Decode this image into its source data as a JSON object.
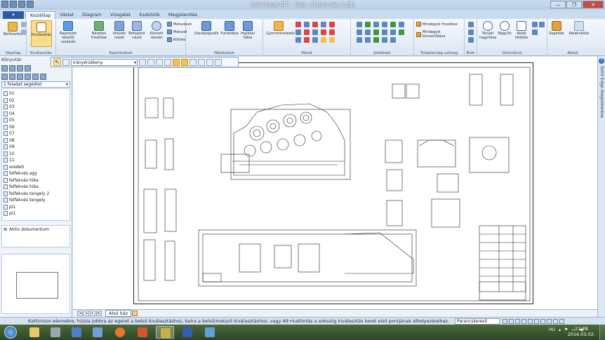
{
  "window": {
    "title": "Solid Edge ST7 - Rajz - [Teljes ház 2.dft]",
    "controls": [
      "—",
      "❐",
      "✕"
    ]
  },
  "tabs": [
    {
      "label": "Kezdőlap",
      "active": true
    },
    {
      "label": "Vázlat"
    },
    {
      "label": "Diagram"
    },
    {
      "label": "Vizsgálat"
    },
    {
      "label": "Eszközök"
    },
    {
      "label": "Megjelenítés"
    }
  ],
  "ribbon": {
    "groups": [
      {
        "name": "Vágólap",
        "buttons": [
          "Beillesztés"
        ]
      },
      {
        "name": "Kiválasztás",
        "buttons": [
          "Kiválasztás"
        ]
      },
      {
        "name": "Rajznézetek",
        "buttons": [
          "Rajznézet készítő varázsló",
          "Nézetek frissítése",
          "Vetületi nézet",
          "Befoglaló nézet",
          "Kiemelt részlet"
        ],
        "small": [
          "Metszések",
          "Metszet",
          "Kitörés"
        ]
      },
      {
        "name": "Táblázatok",
        "buttons": [
          "Darabjegyzék",
          "Furattábla",
          "Hajlítási tábla"
        ]
      },
      {
        "name": "Méret",
        "buttons": [
          "Gyorsméretezés"
        ]
      },
      {
        "name": "Jelölések",
        "buttons": []
      },
      {
        "name": "Tulajdonság szöveg",
        "small": [
          "Mindegyik frissítése",
          "Mindegyik konvertálása"
        ]
      },
      {
        "name": "Élek",
        "buttons": []
      },
      {
        "name": "Orientáció",
        "buttons": [
          "Terület nagyítása",
          "Nagyító",
          "Ablak kitöltés"
        ]
      },
      {
        "name": "Ablak",
        "buttons": [
          "Segédek",
          "Ablakváltás"
        ]
      }
    ]
  },
  "library": {
    "title": "Könyvtár",
    "dropdown": "1 feladat segédlet",
    "items": [
      "01",
      "02",
      "03",
      "04",
      "05",
      "06",
      "07",
      "08",
      "09",
      "10",
      "11",
      "eredeti",
      "felfekvés agy",
      "felfekvés hiba",
      "felfekvés hiba",
      "felfekvés tengely 2",
      "felfekvés tengely",
      "pl1",
      "pl1"
    ],
    "active_doc": "Aktív dokumentum"
  },
  "selection_toolbar": {
    "filter": "Irányérzékeny"
  },
  "help_panel": {
    "label": "Solid Edge megismerése",
    "icon": "?"
  },
  "sheet_tabs": {
    "nav": [
      "|◂",
      "◂",
      "▸",
      "▸|"
    ],
    "active": "Alsó ház"
  },
  "status": {
    "message": "Kattintson elemekre, húzza jobbra az egeret a belső kiválasztáshoz, balra a belső/metsző kiválasztáshoz, vagy Alt+kattintás a sokszög kiválasztás keret első pontjának elhelyezéséhez.",
    "command_finder": "Parancskereső"
  },
  "taskbar": {
    "lang": "HU",
    "time": "11:28",
    "date": "2016.03.02."
  },
  "colors": {
    "ribbon_bg": "#dbe6f2",
    "file_tab": "#2a5aa8",
    "taskbar": "#2c4626"
  }
}
